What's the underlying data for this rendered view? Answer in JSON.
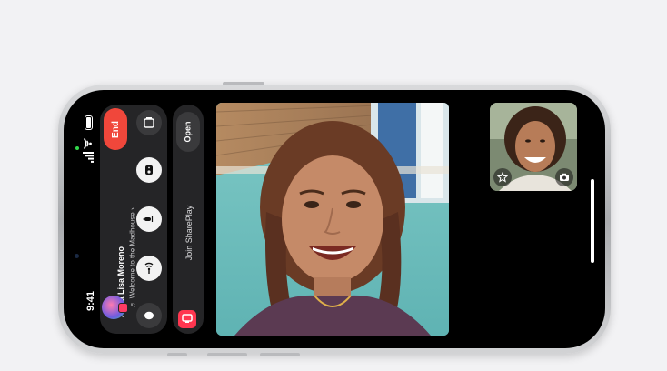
{
  "status_bar": {
    "time": "9:41"
  },
  "call": {
    "end_label": "End",
    "caller_name": "Anna Lisa Moreno",
    "caller_subtitle": "♬ Welcome to the Madhouse ›"
  },
  "shareplay": {
    "open_label": "Open",
    "join_label": "Join SharePlay"
  },
  "colors": {
    "end_red": "#f0473b",
    "panel_bg": "#252527",
    "screen_bg": "#000000"
  },
  "icons": {
    "shareplay": "shareplay-icon",
    "speaker": "speaker-icon",
    "microphone": "microphone-icon",
    "camera": "camera-icon",
    "message": "message-icon",
    "effects": "effects-star-icon",
    "flip_camera": "camera-flip-icon"
  }
}
